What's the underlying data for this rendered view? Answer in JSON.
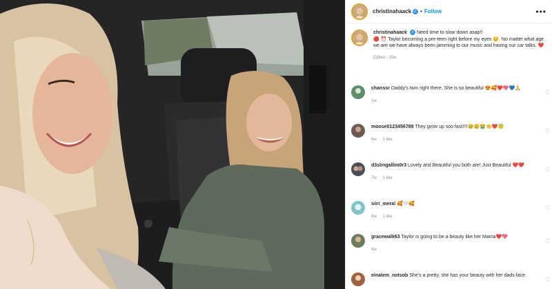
{
  "post": {
    "username": "christinahaack",
    "follow_label": "Follow",
    "more_label": "•••",
    "caption_line1": "Need time to slow down asap!!",
    "caption_line2": "🔴 ⏰ Taylor becoming a pre-teen right before my eyes 😔. No matter what age we are we have always been jamming to our music and having our car talks. ❤️",
    "caption_meta": "Edited · 15w"
  },
  "comments": [
    {
      "username": "chanssr",
      "text": "Daddy's twin right there. She is so beautiful 😍🥰❤️💖💙🙏",
      "time": "1w",
      "likes": "",
      "avatar_color": "#5a8f6a"
    },
    {
      "username": "moose0123456789",
      "text": "They grow up soo fast!!!!😢😢😭👏❤️😇",
      "time": "6w",
      "likes": "1 like",
      "avatar_color": "#6b5b52"
    },
    {
      "username": "d3slingallim0r3",
      "text": "Lovely and Beautiful you both are! Just Beautiful ❤️❤️",
      "time": "7w",
      "likes": "1 like",
      "avatar_color": "#4b4e57"
    },
    {
      "username": "siiri_meral",
      "text": "🥰🤍🥰",
      "time": "8w",
      "likes": "1 like",
      "avatar_color": "#7fc4c8"
    },
    {
      "username": "gracewalk63",
      "text": "Taylor is going to be a beauty like her Mama❤️💖",
      "time": "8w",
      "likes": "",
      "avatar_color": "#6c7f5a"
    },
    {
      "username": "einalem_notsob",
      "text": "She's a pretty, she has your beauty with her dads face.",
      "time": "",
      "likes": "",
      "avatar_color": "#a0623e"
    }
  ],
  "icons": {
    "verified": "verified-badge-icon",
    "heart": "heart-outline-icon",
    "more": "more-options-icon"
  },
  "colors": {
    "follow": "#0095f6",
    "verified": "#3897f0",
    "muted": "#8e8e8e"
  }
}
